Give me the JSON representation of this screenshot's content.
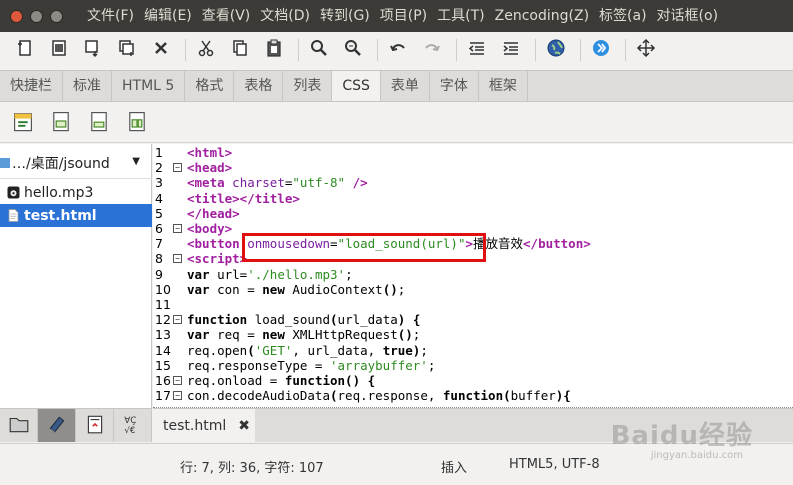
{
  "window": {
    "close_color": "#e0583b"
  },
  "menu": [
    "文件(F)",
    "编辑(E)",
    "查看(V)",
    "文档(D)",
    "转到(G)",
    "项目(P)",
    "工具(T)",
    "Zencoding(Z)",
    "标签(a)",
    "对话框(o)"
  ],
  "toolbar": {
    "groups": [
      [
        "new-icon",
        "open-icon",
        "save-icon",
        "save-all-icon",
        "close-icon"
      ],
      [
        "cut-icon",
        "copy-icon",
        "paste-icon"
      ],
      [
        "search-icon",
        "find-next-icon"
      ],
      [
        "undo-icon",
        "redo-icon"
      ],
      [
        "unindent-icon",
        "indent-icon"
      ],
      [
        "browser-icon"
      ],
      [
        "jump-icon"
      ],
      [
        "fullscreen-icon"
      ]
    ]
  },
  "quickbar_tabs": [
    "快捷栏",
    "标准",
    "HTML 5",
    "格式",
    "表格",
    "列表",
    "CSS",
    "表单",
    "字体",
    "框架"
  ],
  "active_tab": "CSS",
  "css_toolbar": [
    "css-dialog-icon",
    "css-div-icon",
    "css-span-icon",
    "css-class-icon"
  ],
  "side_panel": {
    "path": "…/桌面/jsound",
    "files": [
      {
        "name": "hello.mp3",
        "selected": false,
        "icon": "audio-file-icon"
      },
      {
        "name": "test.html",
        "selected": true,
        "icon": "html-file-icon"
      }
    ],
    "bottom_tabs": [
      "filebrowser-icon",
      "bookmark-icon",
      "documents-icon",
      "charmap-icon"
    ]
  },
  "editor": {
    "lines": [
      {
        "n": "1",
        "fold": "",
        "html": "<span class=\"tag\">&lt;html&gt;</span>"
      },
      {
        "n": "2",
        "fold": "⊟",
        "html": "<span class=\"tag\">&lt;head&gt;</span>"
      },
      {
        "n": "3",
        "fold": "",
        "html": "<span class=\"tag\">&lt;meta</span> <span class=\"attr\">charset</span><span class=\"plain\">=</span><span class=\"str\">\"utf-8\"</span> <span class=\"tag\">/&gt;</span>"
      },
      {
        "n": "4",
        "fold": "",
        "html": "<span class=\"tag\">&lt;title&gt;&lt;/title&gt;</span>"
      },
      {
        "n": "5",
        "fold": "",
        "html": "<span class=\"tag\">&lt;/head&gt;</span>"
      },
      {
        "n": "6",
        "fold": "⊟",
        "html": "<span class=\"tag\">&lt;body&gt;</span>"
      },
      {
        "n": "7",
        "fold": "",
        "html": "<span class=\"tag\">&lt;button</span> <span class=\"attr\">onmousedown</span><span class=\"plain\">=</span><span class=\"str\">\"load_sound(url)\"</span><span class=\"tag\">&gt;</span><span class=\"plain\">播放音效</span><span class=\"tag\">&lt;/button&gt;</span>"
      },
      {
        "n": "8",
        "fold": "⊟",
        "html": "<span class=\"tag\">&lt;script&gt;</span>"
      },
      {
        "n": "9",
        "fold": "",
        "html": "<span class=\"kw\">var</span><span class=\"plain\"> url=</span><span class=\"str\">'./hello.mp3'</span><span class=\"plain\">;</span>"
      },
      {
        "n": "10",
        "fold": "",
        "html": "<span class=\"kw\">var</span><span class=\"plain\"> con = </span><span class=\"kw\">new</span><span class=\"plain\"> AudioContext</span><span class=\"kw\">()</span><span class=\"plain\">;</span>"
      },
      {
        "n": "11",
        "fold": "",
        "html": ""
      },
      {
        "n": "12",
        "fold": "⊟",
        "html": "<span class=\"kw\">function</span><span class=\"plain\"> load_sound</span><span class=\"kw\">(</span><span class=\"plain\">url_data</span><span class=\"kw\">) {</span>"
      },
      {
        "n": "13",
        "fold": "",
        "html": "<span class=\"kw\">var</span><span class=\"plain\"> req = </span><span class=\"kw\">new</span><span class=\"plain\"> XMLHttpRequest</span><span class=\"kw\">()</span><span class=\"plain\">;</span>"
      },
      {
        "n": "14",
        "fold": "",
        "html": "<span class=\"plain\">req.open</span><span class=\"kw\">(</span><span class=\"str\">'GET'</span><span class=\"plain\">, url_data, </span><span class=\"kw\">true)</span><span class=\"plain\">;</span>"
      },
      {
        "n": "15",
        "fold": "",
        "html": "<span class=\"plain\">req.responseType = </span><span class=\"str\">'arraybuffer'</span><span class=\"plain\">;</span>"
      },
      {
        "n": "16",
        "fold": "⊟",
        "html": "<span class=\"plain\">req.onload = </span><span class=\"kw\">function() {</span>"
      },
      {
        "n": "17",
        "fold": "⊟",
        "html": "<span class=\"plain\">con.decodeAudioData</span><span class=\"kw\">(</span><span class=\"plain\">req.response, </span><span class=\"kw\">function(</span><span class=\"plain\">buffer</span><span class=\"kw\">){</span>"
      }
    ],
    "highlight_color": "#e01010"
  },
  "document_tab": {
    "name": "test.html",
    "close": "✖"
  },
  "status": {
    "position": "行: 7, 列: 36, 字符: 107",
    "mode": "插入",
    "encoding": "HTML5, UTF-8"
  },
  "watermark": {
    "text": "Baidu经验",
    "sub": "jingyan.baidu.com"
  }
}
